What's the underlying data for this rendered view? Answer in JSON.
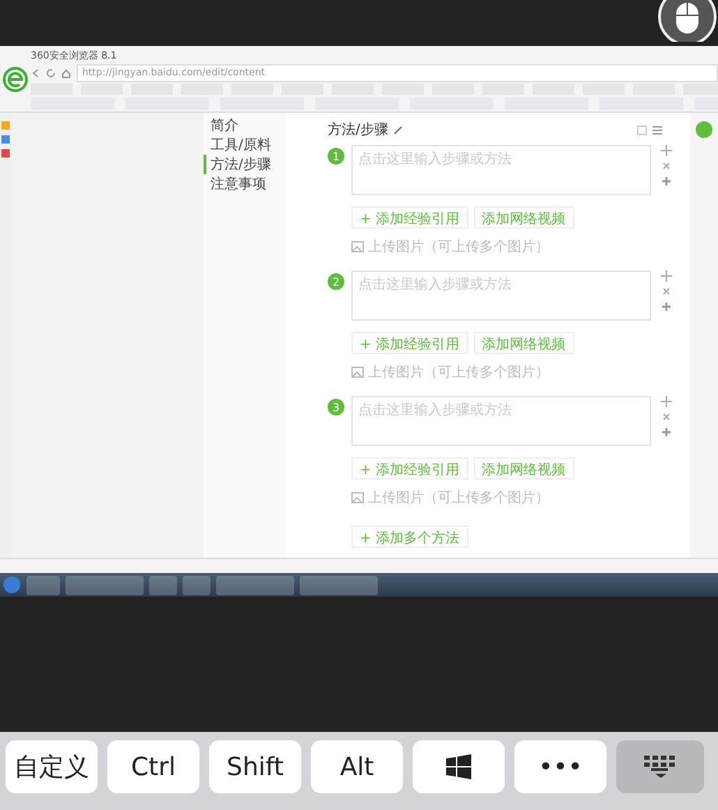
{
  "browser": {
    "title": "360安全浏览器 8.1",
    "address": "http://jingyan.baidu.com/edit/content"
  },
  "outline": [
    {
      "label": "简介",
      "selected": false
    },
    {
      "label": "工具/原料",
      "selected": false
    },
    {
      "label": "方法/步骤",
      "selected": true
    },
    {
      "label": "注意事项",
      "selected": false
    }
  ],
  "editor": {
    "heading": "方法/步骤",
    "steps": [
      {
        "number": "1",
        "placeholder": "点击这里输入步骤或方法",
        "buttons": [
          "+ 添加经验引用",
          "添加网络视频"
        ],
        "hint": "上传图片（可上传多个图片）"
      },
      {
        "number": "2",
        "placeholder": "点击这里输入步骤或方法",
        "buttons": [
          "+ 添加经验引用",
          "添加网络视频"
        ],
        "hint": "上传图片（可上传多个图片）"
      },
      {
        "number": "3",
        "placeholder": "点击这里输入步骤或方法",
        "buttons": [
          "+ 添加经验引用",
          "添加网络视频"
        ],
        "hint": "上传图片（可上传多个图片）"
      }
    ],
    "add_method": "+ 添加多个方法"
  },
  "keyboard_bar": [
    {
      "kind": "text",
      "label": "自定义"
    },
    {
      "kind": "text",
      "label": "Ctrl"
    },
    {
      "kind": "text",
      "label": "Shift"
    },
    {
      "kind": "text",
      "label": "Alt"
    },
    {
      "kind": "windows"
    },
    {
      "kind": "text",
      "label": "•••"
    },
    {
      "kind": "hide"
    }
  ]
}
